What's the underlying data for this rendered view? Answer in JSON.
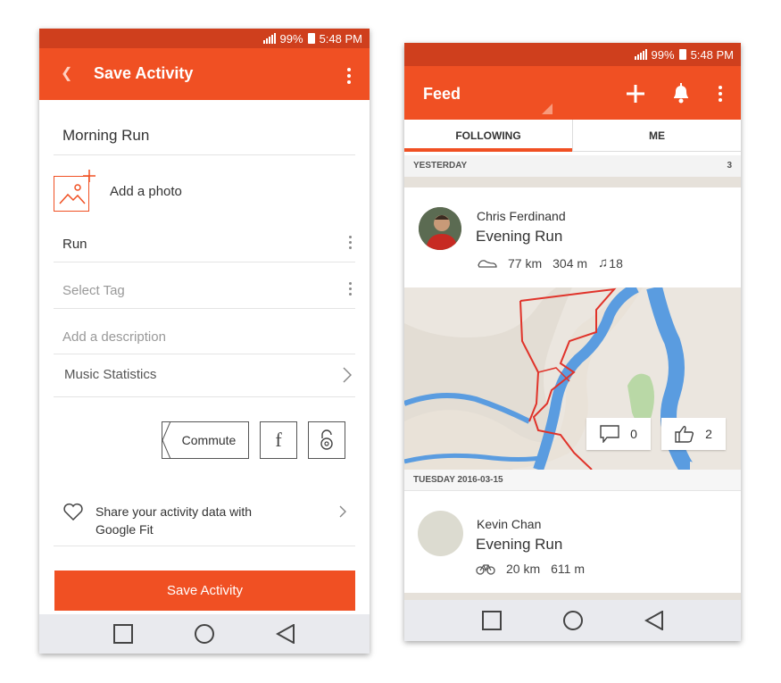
{
  "status": {
    "battery": "99%",
    "time": "5:48 PM"
  },
  "save_screen": {
    "title": "Save Activity",
    "activity_name": "Morning Run",
    "add_photo_label": "Add a photo",
    "activity_type": "Run",
    "select_tag_placeholder": "Select Tag",
    "description_placeholder": "Add a description",
    "music_statistics_label": "Music Statistics",
    "commute_label": "Commute",
    "share_google_fit_line1": "Share your activity data with",
    "share_google_fit_line2": "Google Fit",
    "save_button_label": "Save Activity"
  },
  "feed_screen": {
    "title": "Feed",
    "tabs": [
      {
        "label": "FOLLOWING",
        "active": true
      },
      {
        "label": "ME",
        "active": false
      }
    ],
    "sections": [
      {
        "label": "YESTERDAY",
        "count": "3"
      },
      {
        "label": "TUESDAY 2016-03-15",
        "count": ""
      }
    ],
    "activities": [
      {
        "athlete": "Chris  Ferdinand",
        "title": "Evening Run",
        "type_icon": "shoe-icon",
        "distance": "77 km",
        "elevation": "304 m",
        "music": "18",
        "comments": "0",
        "kudos": "2"
      },
      {
        "athlete": "Kevin Chan",
        "title": "Evening Run",
        "type_icon": "bike-icon",
        "distance": "20 km",
        "elevation": "611 m"
      }
    ]
  },
  "colors": {
    "accent": "#f05023",
    "status_bar": "#cf3f1d",
    "nav_bar": "#e9eaee"
  }
}
